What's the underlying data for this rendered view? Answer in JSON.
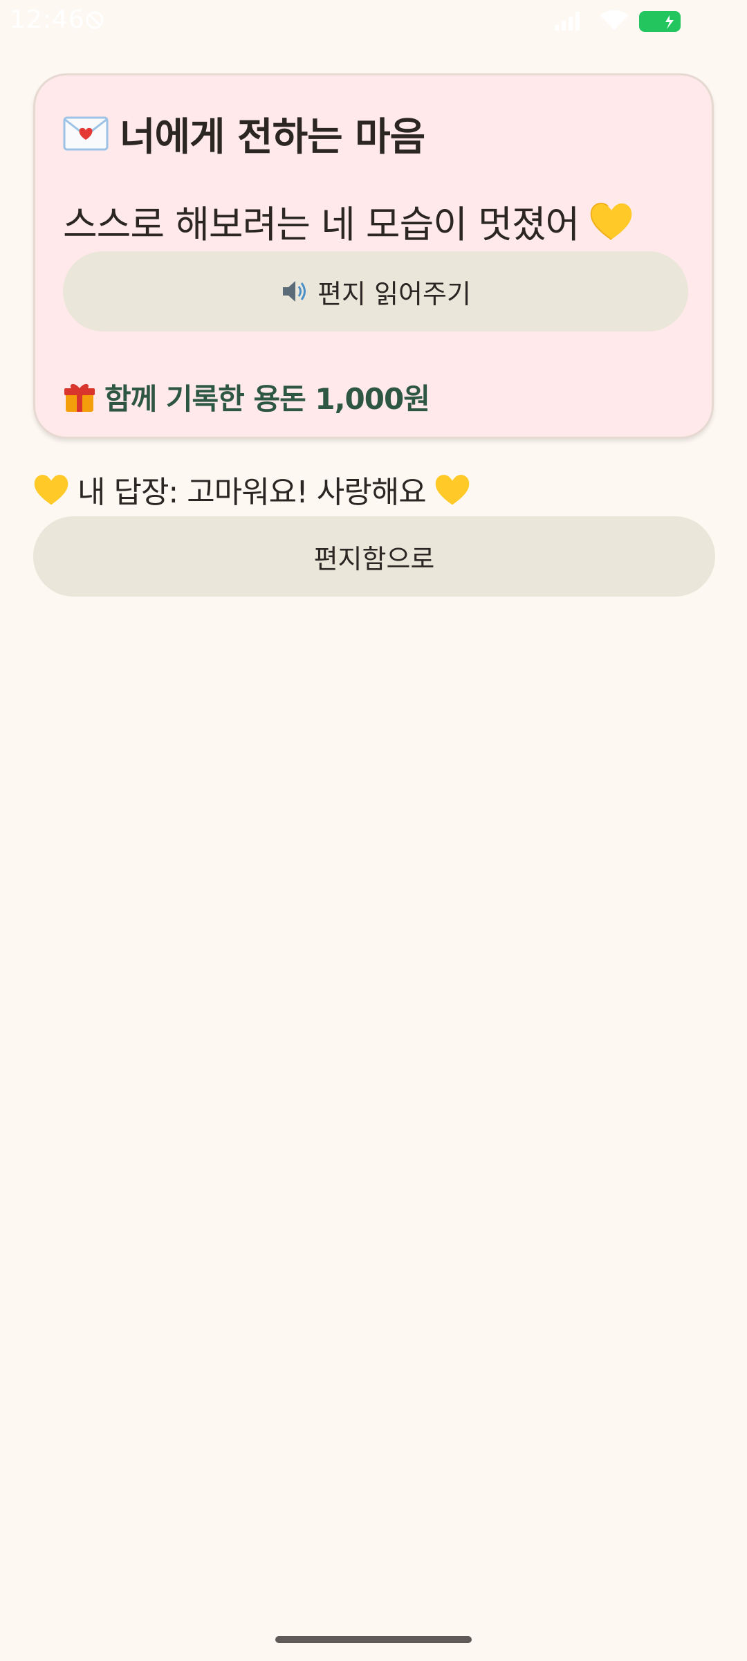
{
  "status_bar": {
    "time": "12:46",
    "battery_color": "#22C55E"
  },
  "letter_card": {
    "title_icon": "envelope-heart-icon",
    "title": "너에게 전하는 마음",
    "message": "스스로 해보려는 네 모습이 멋졌어",
    "message_icon": "yellow-heart-icon",
    "read_aloud_icon": "speaker-icon",
    "read_aloud_label": "편지 읽어주기",
    "allowance_icon": "gift-icon",
    "allowance_text": "함께 기록한 용돈 1,000원",
    "background_color": "#FFE9EA",
    "allowance_color": "#2E5741"
  },
  "reply": {
    "icon": "yellow-heart-icon",
    "text": "내 답장: 고마워요! 사랑해요"
  },
  "mailbox_button": {
    "label": "편지함으로"
  },
  "colors": {
    "background": "#FDF8F2",
    "button_background": "#EBE6DA",
    "text": "#2B2623"
  }
}
